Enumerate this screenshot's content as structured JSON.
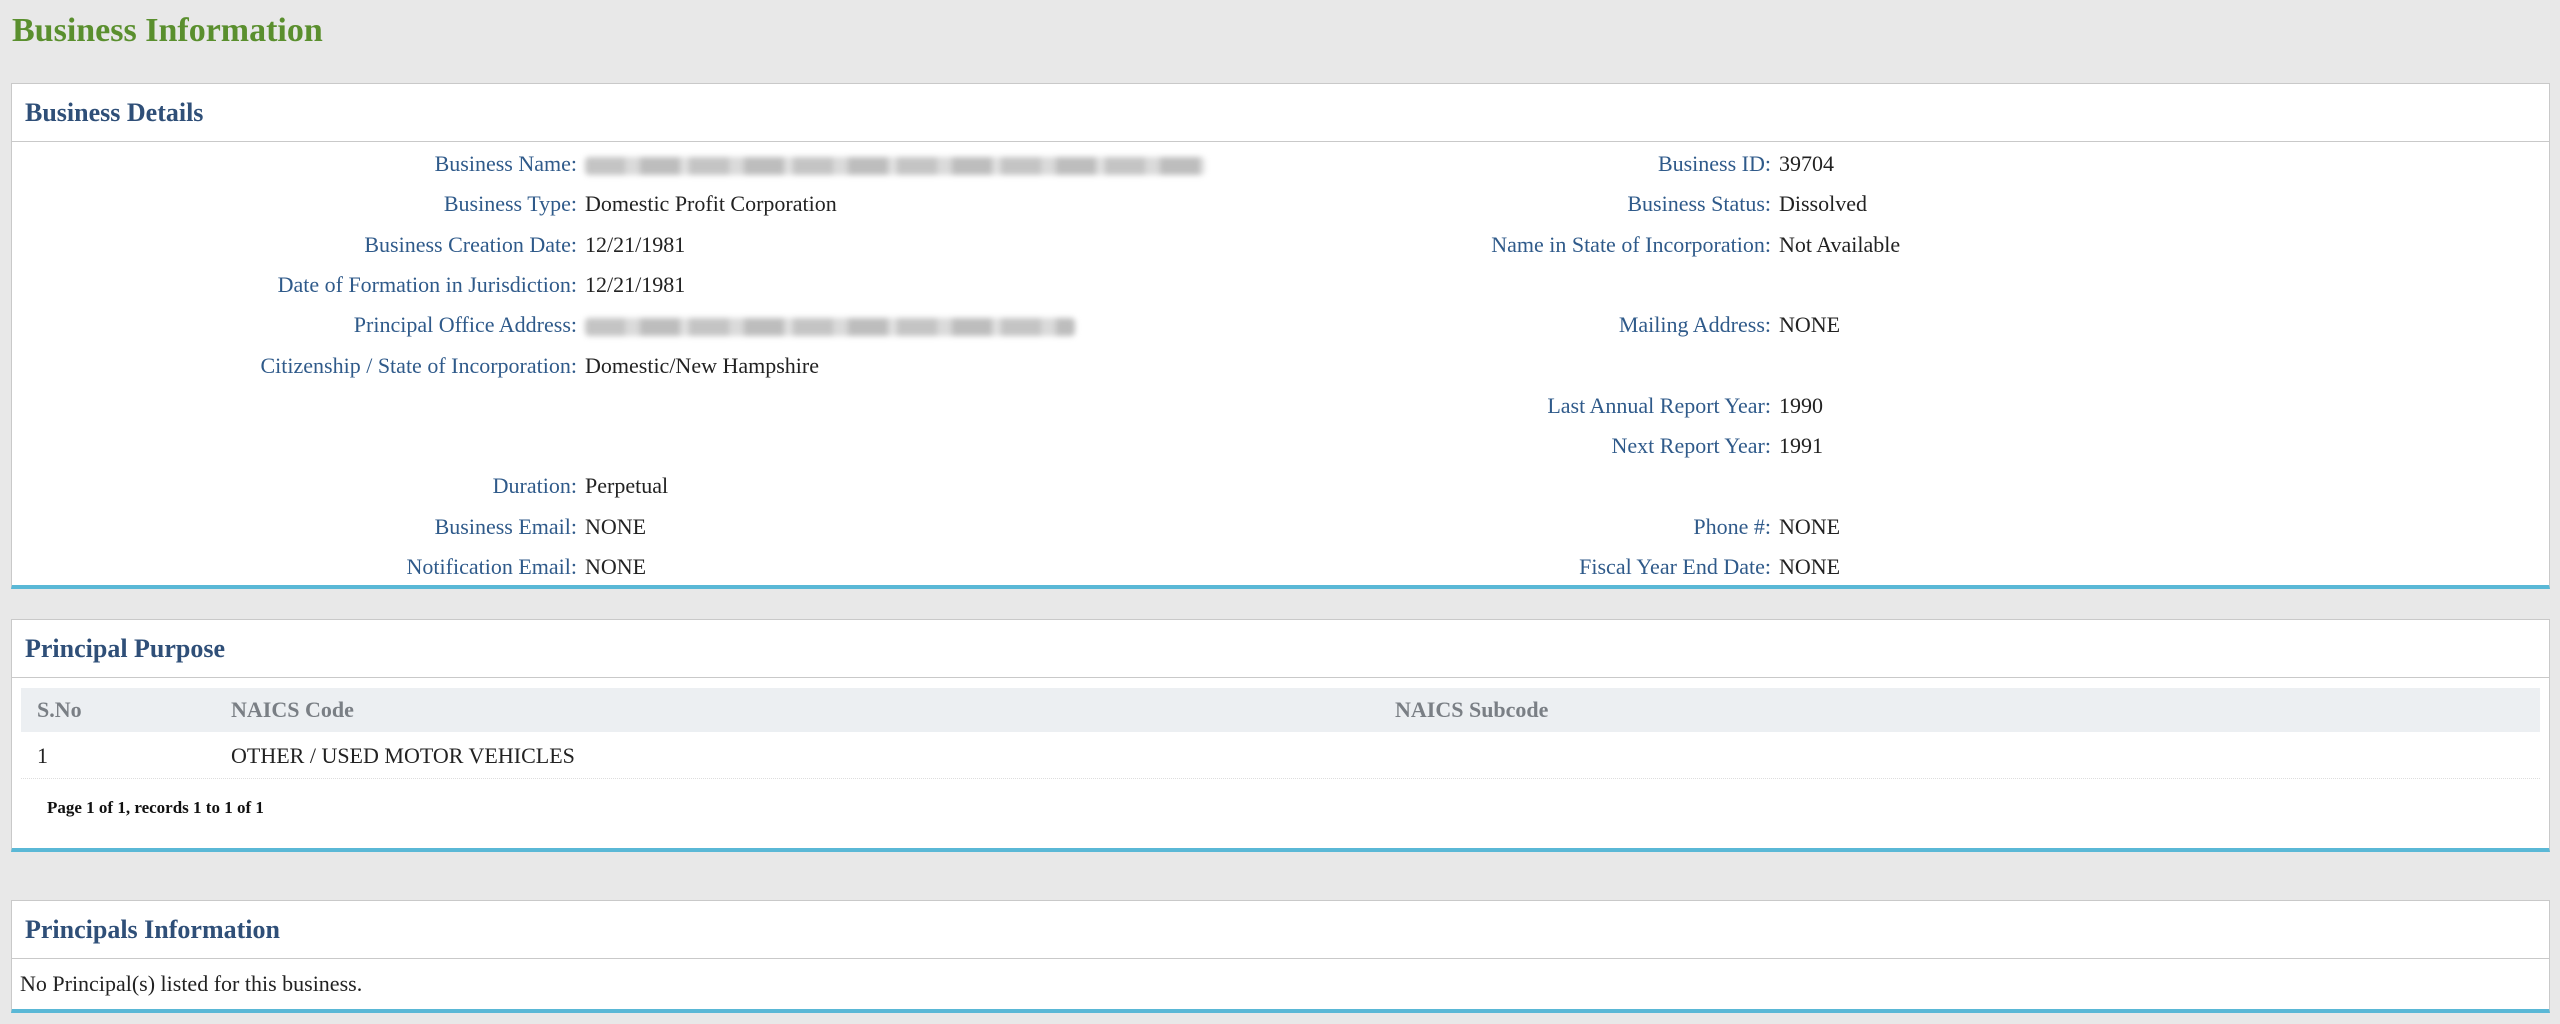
{
  "page_title": "Business Information",
  "business_details": {
    "title": "Business Details",
    "rows": [
      {
        "left_label": "Business Name:",
        "left_value": "",
        "left_blurred": true,
        "right_label": "Business ID:",
        "right_value": "39704"
      },
      {
        "left_label": "Business Type:",
        "left_value": "Domestic Profit Corporation",
        "right_label": "Business Status:",
        "right_value": "Dissolved"
      },
      {
        "left_label": "Business Creation Date:",
        "left_value": "12/21/1981",
        "right_label": "Name in State of Incorporation:",
        "right_value": "Not Available"
      },
      {
        "left_label": "Date of Formation in Jurisdiction:",
        "left_value": "12/21/1981",
        "right_label": "",
        "right_value": ""
      },
      {
        "left_label": "Principal Office Address:",
        "left_value": "",
        "left_blurred": true,
        "right_label": "Mailing Address:",
        "right_value": "NONE"
      },
      {
        "left_label": "Citizenship / State of Incorporation:",
        "left_value": "Domestic/New Hampshire",
        "right_label": "",
        "right_value": ""
      },
      {
        "left_label": "",
        "left_value": "",
        "right_label": "Last Annual Report Year:",
        "right_value": "1990"
      },
      {
        "left_label": "",
        "left_value": "",
        "right_label": "Next Report Year:",
        "right_value": "1991"
      },
      {
        "left_label": "Duration:",
        "left_value": "Perpetual",
        "right_label": "",
        "right_value": ""
      },
      {
        "left_label": "Business Email:",
        "left_value": "NONE",
        "right_label": "Phone #:",
        "right_value": "NONE"
      },
      {
        "left_label": "Notification Email:",
        "left_value": "NONE",
        "right_label": "Fiscal Year End Date:",
        "right_value": "NONE"
      }
    ]
  },
  "principal_purpose": {
    "title": "Principal Purpose",
    "columns": [
      "S.No",
      "NAICS Code",
      "NAICS Subcode"
    ],
    "rows": [
      [
        "1",
        "OTHER / USED MOTOR VEHICLES",
        ""
      ]
    ],
    "pager": "Page 1 of 1, records 1 to 1 of 1"
  },
  "principals_information": {
    "title": "Principals Information",
    "message": "No Principal(s) listed for this business."
  }
}
